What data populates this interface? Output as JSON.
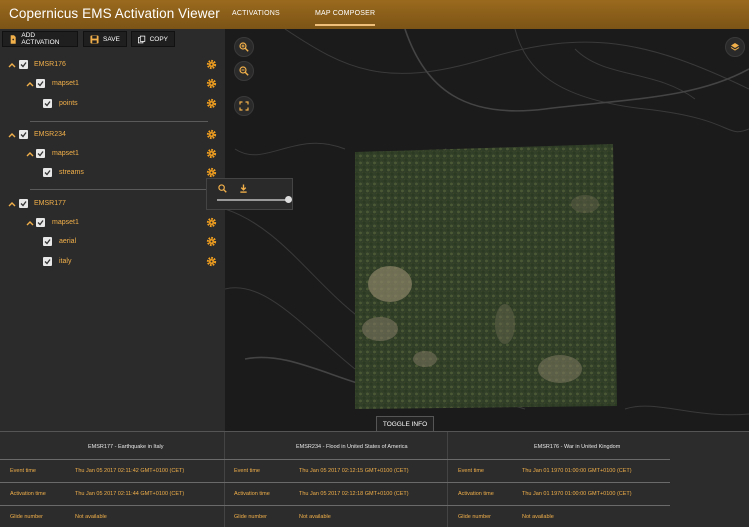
{
  "app": {
    "title": "Copernicus EMS Activation Viewer"
  },
  "tabs": [
    {
      "label": "ACTIVATIONS",
      "active": false
    },
    {
      "label": "MAP COMPOSER",
      "active": true
    }
  ],
  "toolbar": {
    "add_label": "ADD ACTIVATION",
    "save_label": "SAVE",
    "copy_label": "COPY"
  },
  "tree": [
    {
      "name": "EMSR176",
      "mapset": "mapset1",
      "layers": [
        "points"
      ]
    },
    {
      "name": "EMSR234",
      "mapset": "mapset1",
      "layers": [
        "streams"
      ]
    },
    {
      "name": "EMSR177",
      "mapset": "mapset1",
      "layers": [
        "aerial",
        "italy"
      ]
    }
  ],
  "layer_popover": {
    "opacity": 1.0
  },
  "map": {
    "toggle_info_label": "TOGGLE INFO"
  },
  "info": {
    "row_labels": [
      "Event time",
      "Activation time",
      "Glide number"
    ],
    "columns": [
      {
        "title": "EMSR177 - Earthquake in Italy",
        "event_time": "Thu Jan 05 2017 02:11:42 GMT+0100 (CET)",
        "activation_time": "Thu Jan 05 2017 02:11:44 GMT+0100 (CET)",
        "glide": "Not available"
      },
      {
        "title": "EMSR234 - Flood in United States of America",
        "event_time": "Thu Jan 05 2017 02:12:15 GMT+0100 (CET)",
        "activation_time": "Thu Jan 05 2017 02:12:18 GMT+0100 (CET)",
        "glide": "Not available"
      },
      {
        "title": "EMSR176 - War in United Kingdom",
        "event_time": "Thu Jan 01 1970 01:00:00 GMT+0100 (CET)",
        "activation_time": "Thu Jan 01 1970 01:00:00 GMT+0100 (CET)",
        "glide": "Not available"
      }
    ]
  },
  "colors": {
    "accent": "#f2b04a",
    "header": "#8a5e1a",
    "sidebar": "#2b2b2b",
    "map_bg": "#1b1b1b"
  }
}
